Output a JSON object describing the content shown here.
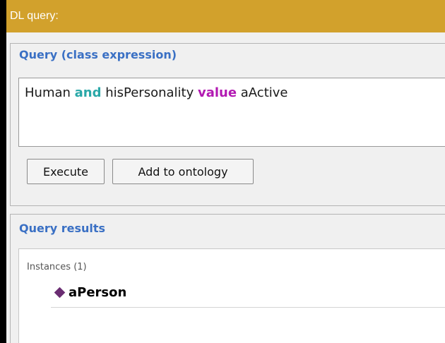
{
  "window": {
    "title": "DL query:"
  },
  "query_section": {
    "title": "Query (class expression)",
    "expression": [
      {
        "text": "Human ",
        "kind": "plain"
      },
      {
        "text": "and",
        "kind": "keyword-and"
      },
      {
        "text": " hisPersonality ",
        "kind": "plain"
      },
      {
        "text": "value",
        "kind": "keyword-value"
      },
      {
        "text": " aActive",
        "kind": "plain"
      }
    ]
  },
  "buttons": {
    "execute": "Execute",
    "add_to_ontology": "Add to ontology"
  },
  "results_section": {
    "title": "Query results",
    "instances_label": "Instances (1)",
    "items": [
      {
        "label": "aPerson",
        "icon": "individual-diamond-icon"
      }
    ]
  },
  "colors": {
    "title_bar": "#d2a12c",
    "section_title": "#3a70c4",
    "keyword_and": "#2aa8a8",
    "keyword_value": "#b21ab2",
    "individual_icon": "#6a2d72"
  }
}
